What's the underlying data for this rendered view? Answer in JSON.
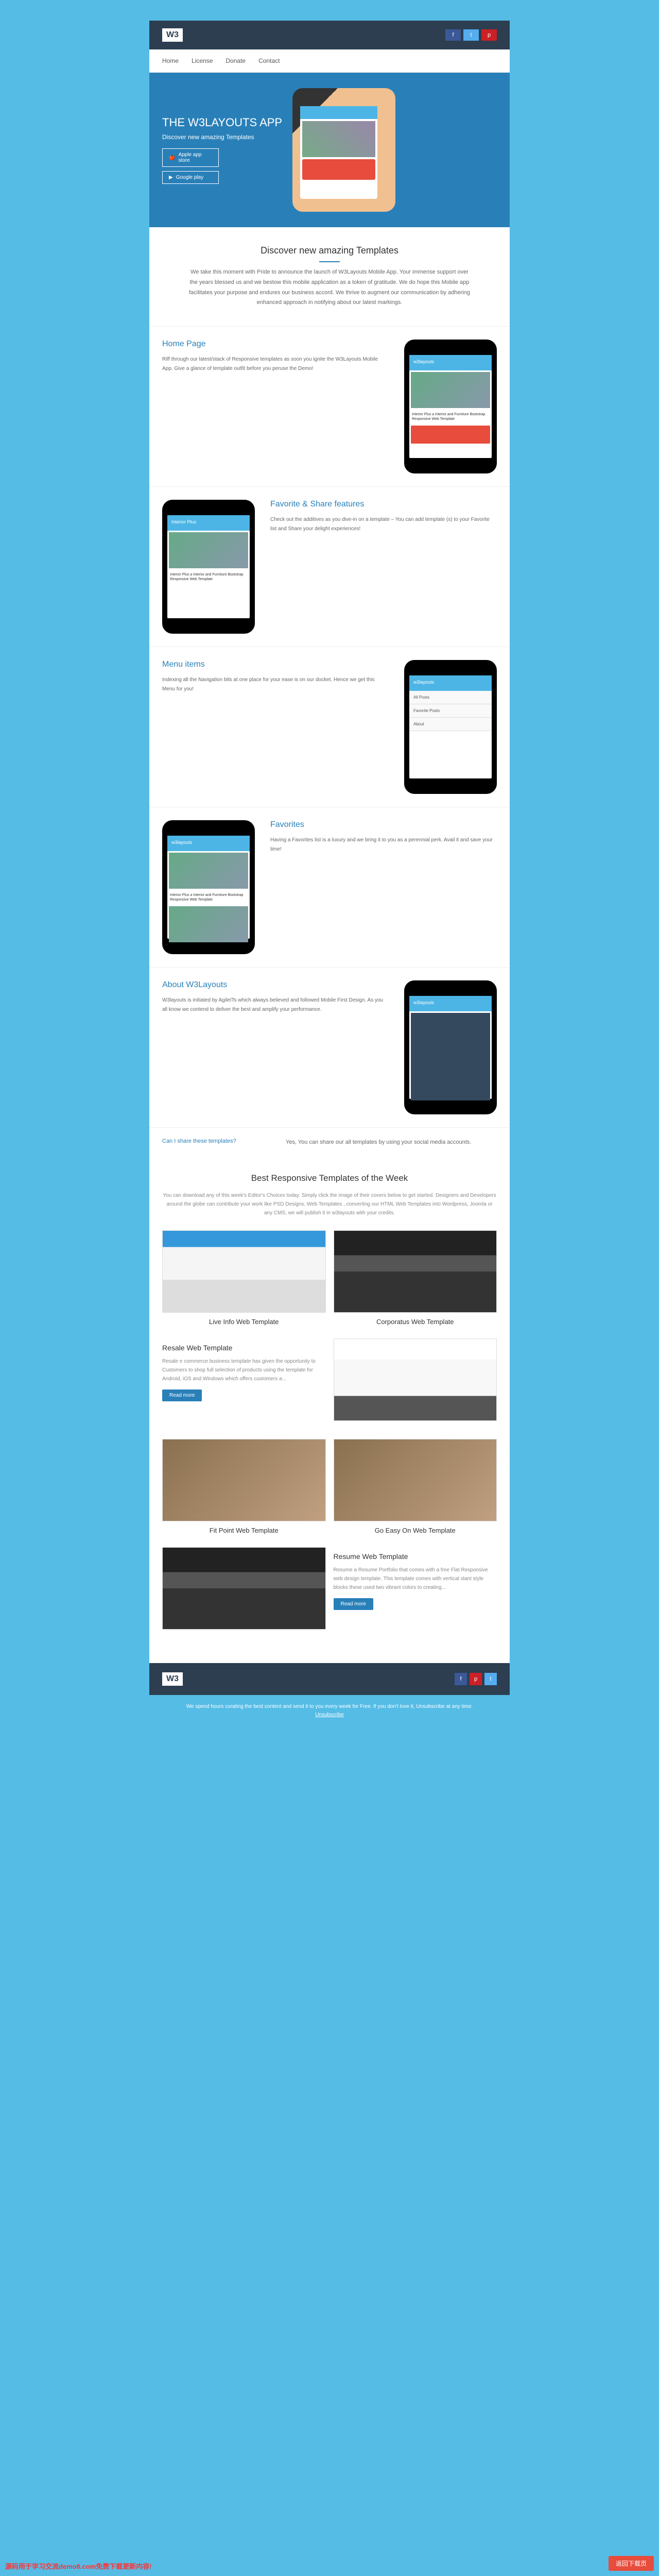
{
  "header": {
    "logo": "W3"
  },
  "social": {
    "fb": "f",
    "tw": "t",
    "pin": "p"
  },
  "nav": [
    "Home",
    "License",
    "Donate",
    "Contact"
  ],
  "hero": {
    "title": "THE W3LAYOUTS APP",
    "subtitle": "Discover new amazing Templates",
    "appstore": "Apple app store",
    "gplay": "Google play"
  },
  "discover": {
    "title": "Discover new amazing Templates",
    "text": "We take this moment with Pride to announce the launch of W3Layouts Mobile App. Your immense support over the years blessed us and we bestow this mobile application as a token of gratitude. We do hope this Mobile app facilitates your purpose and endures our business accord. We thrive to augment our communication by adhering enhanced approach in notifying about our latest markings."
  },
  "features": [
    {
      "title": "Home Page",
      "text": "Riff through our latest/stack of Responsive templates as soon you ignite the W3Layouts Mobile App. Give a glance of template outfit before you peruse the Demo!"
    },
    {
      "title": "Favorite & Share features",
      "text": "Check out the additives as you dive-in on a template – You can add template (s) to your Favorite list and Share your delight experiences!"
    },
    {
      "title": "Menu items",
      "text": "Indexing all the Navigation bits at one place for your ease is on our docket. Hence we get this Menu for you!"
    },
    {
      "title": "Favorites",
      "text": "Having a Favorites list is a luxury and we bring it to you as a perennial perk. Avail it and save your time!"
    },
    {
      "title": "About W3Layouts",
      "text": "W3layouts is initiated by AgileITs which always believed and followed Mobile First Design. As you all know we contend to deliver the best and amplify your performance."
    }
  ],
  "phone_labels": {
    "header": "w3layouts",
    "interior": "Interior Plus",
    "card_text": "Interior Plus a Interior and Furniture Bootstrap Responsive Web Template",
    "menu": [
      "All Posts",
      "Favorite Posts",
      "About"
    ]
  },
  "share": {
    "q": "Can I share these templates?",
    "a": "Yes, You can share our all templates by using your social media accounts."
  },
  "templates_section": {
    "title": "Best Responsive Templates of the Week",
    "intro": "You can download any of this week's Editor's Choices today. Simply click the image of their covers below to get started. Designers and Developers around the globe can contribute your work like PSD Designs, Web Templates , converting our HTML Web Templates into Wordpress, Joomla or any CMS, we will publish it in w3layouts with your credits.",
    "cards": [
      {
        "name": "Live Info Web Template"
      },
      {
        "name": "Corporatus Web Template"
      },
      {
        "name": "Resale Web Template",
        "desc": "Resale e commerce business template has given the opportunity to Customers to shop full selection of products using the template for Android, iOS and Windows which offers customers a...",
        "btn": "Read more"
      },
      {
        "name": "Fit Point Web Template"
      },
      {
        "name": "Go Easy On Web Template"
      },
      {
        "name": "Resume Web Template",
        "desc": "Resume a Resume Portfolio that comes with a free Flat Responsive web design template. This template comes with vertical slant style blocks these used two vibrant colors to creating...",
        "btn": "Read more"
      }
    ]
  },
  "footer_text": "We spend hours curating the best content and send it to you every week for Free. If you don't love it, Unsubscribe at any time.",
  "unsub": "Unsubscribe",
  "watermark": "源码用于学习交流demo8.com免费下载更新内容!",
  "redbtn": "返回下载页"
}
